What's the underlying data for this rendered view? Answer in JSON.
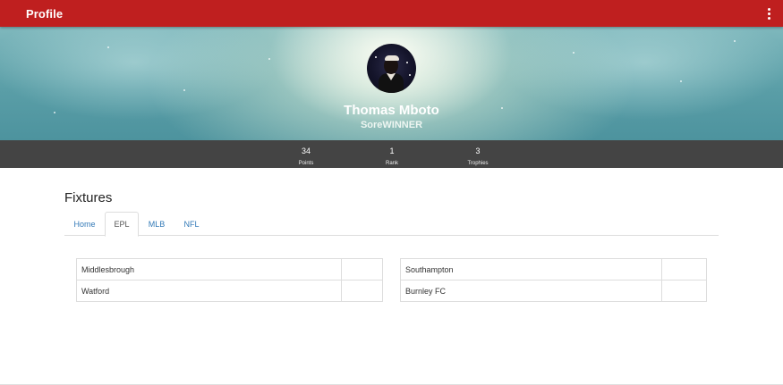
{
  "appbar": {
    "title": "Profile",
    "menu_icon": "more-vert-icon",
    "color": "#bf1f1f"
  },
  "profile": {
    "name": "Thomas Mboto",
    "handle": "SoreWINNER"
  },
  "stats": [
    {
      "value": "34",
      "label": "Points"
    },
    {
      "value": "1",
      "label": "Rank"
    },
    {
      "value": "3",
      "label": "Trophies"
    }
  ],
  "fixtures": {
    "title": "Fixtures",
    "tabs": [
      "Home",
      "EPL",
      "MLB",
      "NFL"
    ],
    "active_tab": "EPL",
    "left_table": [
      {
        "team": "Middlesbrough",
        "score": ""
      },
      {
        "team": "Watford",
        "score": ""
      }
    ],
    "right_table": [
      {
        "team": "Southampton",
        "score": ""
      },
      {
        "team": "Burnley FC",
        "score": ""
      }
    ]
  },
  "colors": {
    "stats_bar": "#444444",
    "link": "#337ab7"
  }
}
